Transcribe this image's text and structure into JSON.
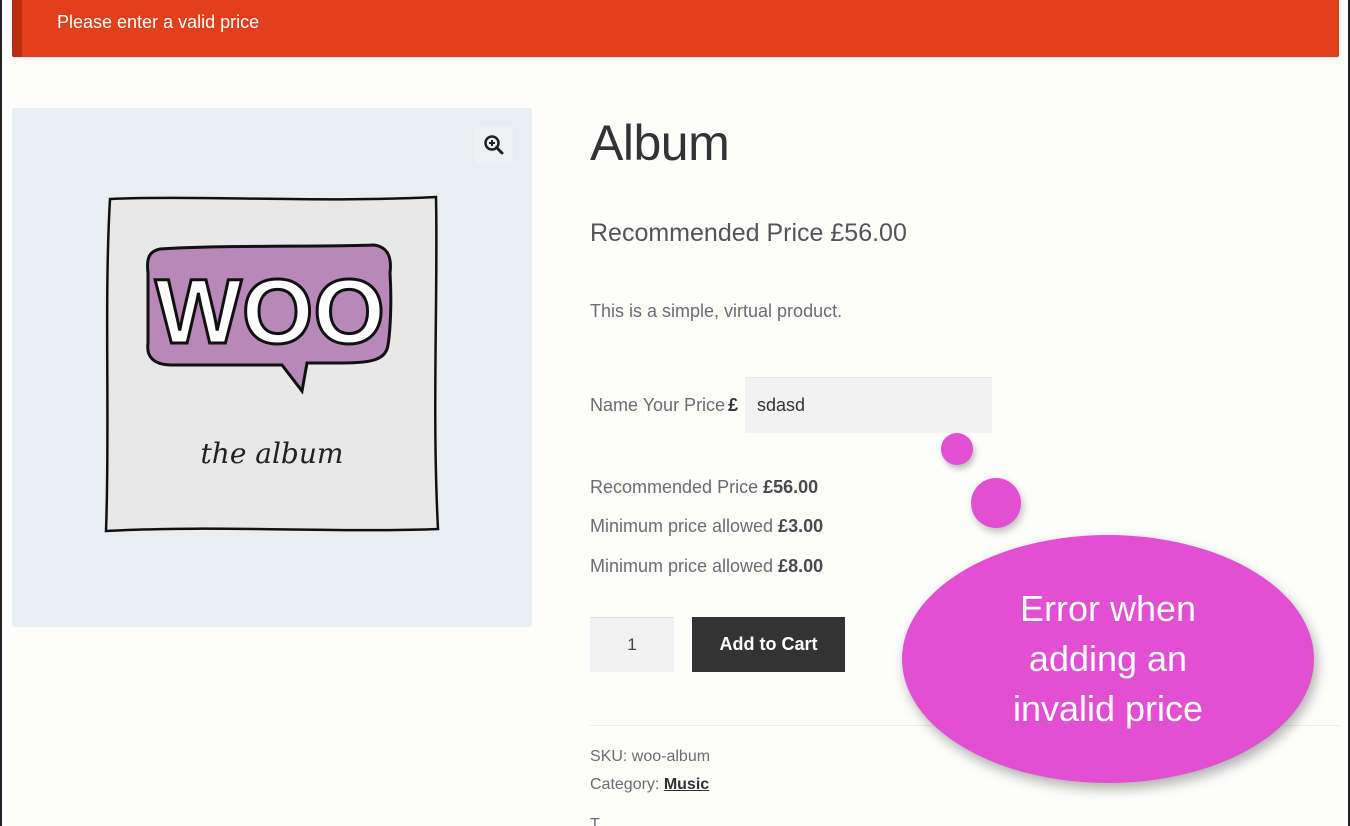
{
  "notice": {
    "text": "Please enter a valid price"
  },
  "gallery": {
    "zoom_icon": "magnifier-plus-icon",
    "cover_alt_word": "WOO",
    "cover_subtitle": "the album"
  },
  "product": {
    "title": "Album",
    "recommended_price_heading": "Recommended Price £56.00",
    "description": "This is a simple, virtual product.",
    "name_your_price_label": "Name Your Price",
    "currency_symbol": "£",
    "price_input_value": "sdasd",
    "info": [
      {
        "label": "Recommended Price ",
        "value": "£56.00"
      },
      {
        "label": "Minimum price allowed ",
        "value": "£3.00"
      },
      {
        "label": "Minimum price allowed ",
        "value": "£8.00"
      }
    ],
    "quantity": "1",
    "add_to_cart_label": "Add to Cart",
    "sku_label": "SKU: ",
    "sku_value": "woo-album",
    "category_label": "Category: ",
    "category_value": "Music",
    "cut_text": "T..."
  },
  "callout": {
    "text": "Error when adding an invalid price"
  },
  "colors": {
    "notice": "#e2401c",
    "callout": "#e24fd3",
    "button": "#333333"
  }
}
